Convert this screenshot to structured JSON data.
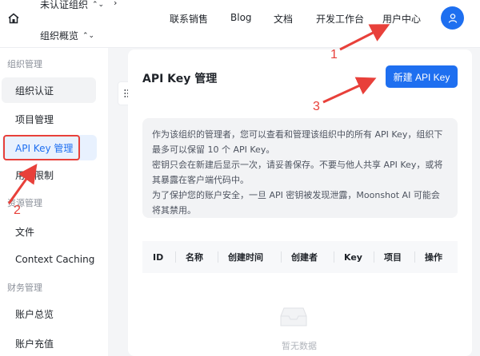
{
  "header": {
    "org_name": "未认证组织",
    "org_overview": "组织概览",
    "nav": [
      "联系销售",
      "Blog",
      "文档",
      "开发工作台",
      "用户中心"
    ]
  },
  "sidebar": {
    "group1": "组织管理",
    "items1": [
      "组织认证",
      "项目管理",
      "API Key 管理",
      "用户限制"
    ],
    "group2": "资源管理",
    "items2": [
      "文件",
      "Context Caching"
    ],
    "group3": "财务管理",
    "items3": [
      "账户总览",
      "账户充值"
    ]
  },
  "main": {
    "title": "API Key 管理",
    "new_button": "新建 API Key",
    "info": [
      "作为该组织的管理者，您可以查看和管理该组织中的所有 API Key，组织下最多可以保留 10 个 API Key。",
      "密钥只会在新建后显示一次，请妥善保存。不要与他人共享 API Key，或将其暴露在客户端代码中。",
      "为了保护您的账户安全，一旦 API 密钥被发现泄露，Moonshot AI 可能会将其禁用。"
    ],
    "columns": [
      "ID",
      "名称",
      "创建时间",
      "创建者",
      "Key",
      "项目",
      "操作"
    ],
    "empty": "暂无数据"
  },
  "annotations": {
    "n1": "1",
    "n2": "2",
    "n3": "3",
    "color": "#e8403a"
  },
  "colors": {
    "accent": "#1e6ff0"
  }
}
